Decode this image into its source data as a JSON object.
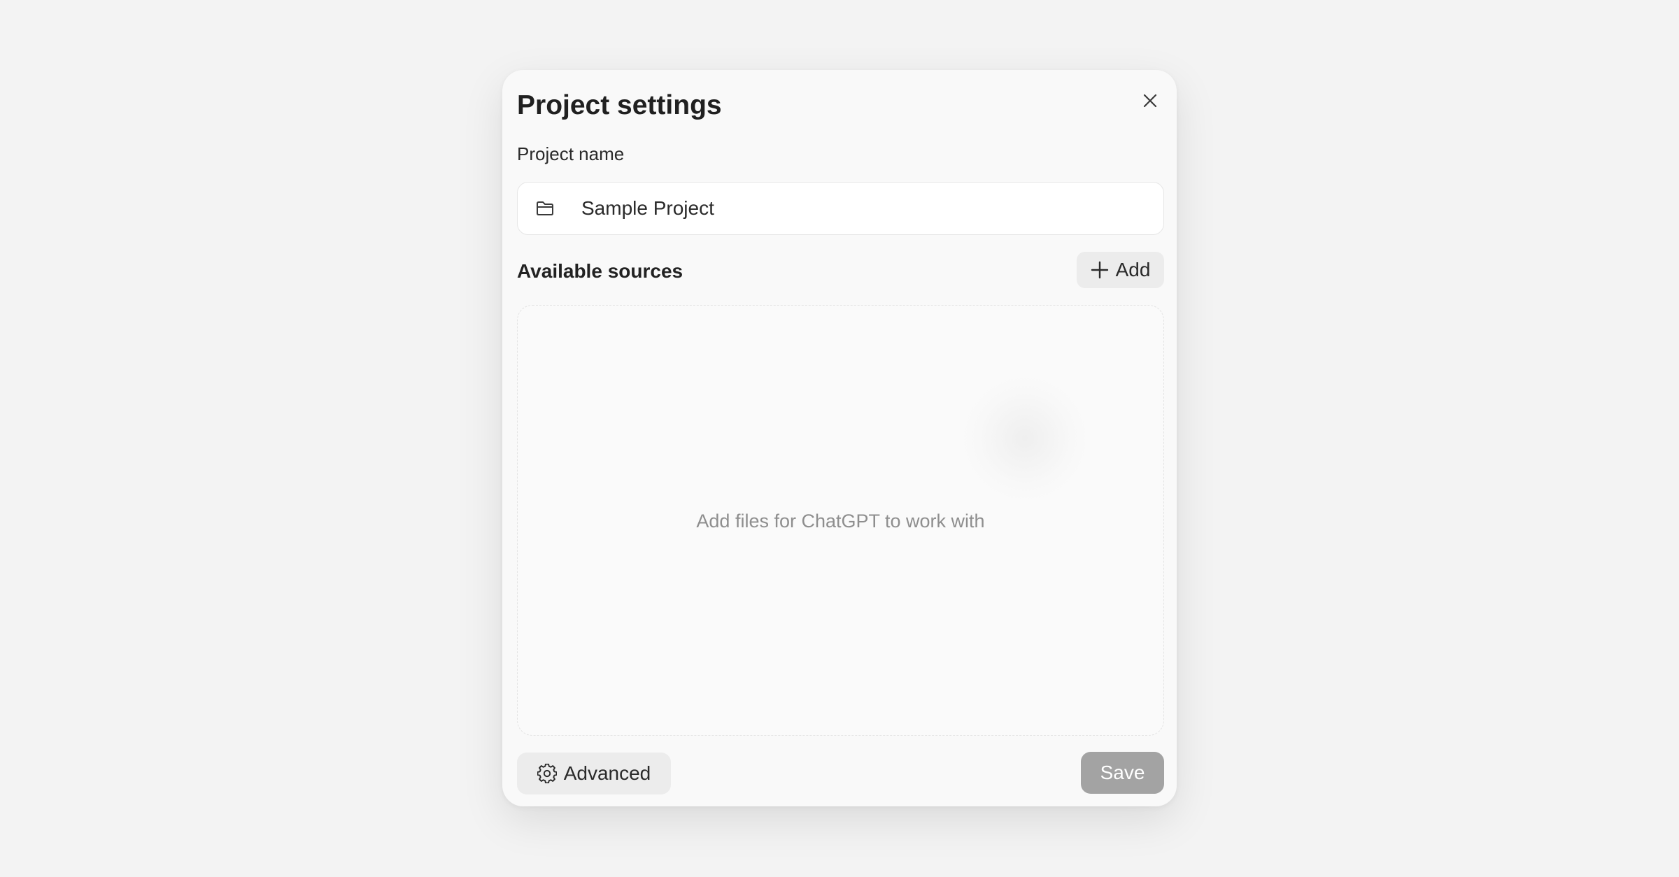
{
  "modal": {
    "title": "Project settings",
    "close_icon": "close-icon"
  },
  "project_name": {
    "label": "Project name",
    "value": "Sample Project",
    "icon": "folder-icon"
  },
  "sources": {
    "heading": "Available sources",
    "add_label": "Add",
    "add_icon": "plus-icon",
    "empty_hint": "Add files for ChatGPT to work with"
  },
  "footer": {
    "advanced_label": "Advanced",
    "advanced_icon": "gear-icon",
    "save_label": "Save"
  },
  "colors": {
    "background": "#f3f3f3",
    "modal": "#f9f9f9",
    "save_button_disabled": "#a3a3a3",
    "secondary_button": "#ececec"
  }
}
